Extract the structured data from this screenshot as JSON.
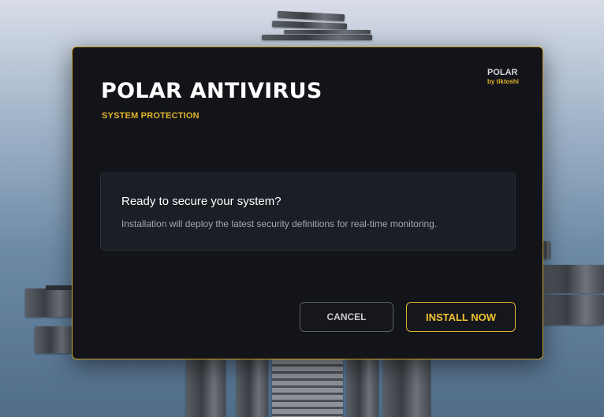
{
  "dialog": {
    "title": "POLAR ANTIVIRUS",
    "subtitle": "SYSTEM PROTECTION",
    "brand": {
      "name": "POLAR",
      "by": "by tiktoshi"
    },
    "panel": {
      "heading": "Ready to secure your system?",
      "body": "Installation will deploy the latest security definitions for real-time monitoring."
    },
    "buttons": {
      "cancel": "CANCEL",
      "install": "INSTALL NOW"
    }
  },
  "colors": {
    "accent": "#e0b42a",
    "dialog_bg": "#121419",
    "panel_bg": "#1b1e25"
  }
}
